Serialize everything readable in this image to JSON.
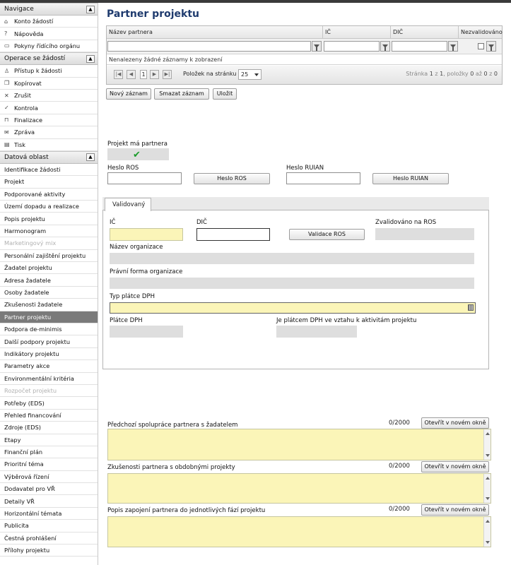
{
  "sidebar": {
    "sections": [
      {
        "title": "Navigace",
        "items": [
          {
            "label": "Konto žádostí",
            "icon": "home-icon",
            "glyph": "⌂"
          },
          {
            "label": "Nápověda",
            "icon": "help-icon",
            "glyph": "?"
          },
          {
            "label": "Pokyny řídícího orgánu",
            "icon": "book-icon",
            "glyph": "▭"
          }
        ]
      },
      {
        "title": "Operace se žádostí",
        "items": [
          {
            "label": "Přístup k žádosti",
            "icon": "user-icon",
            "glyph": "♙"
          },
          {
            "label": "Kopírovat",
            "icon": "copy-icon",
            "glyph": "❐"
          },
          {
            "label": "Zrušit",
            "icon": "close-icon",
            "glyph": "✕"
          },
          {
            "label": "Kontrola",
            "icon": "check-icon",
            "glyph": "✓"
          },
          {
            "label": "Finalizace",
            "icon": "lock-icon",
            "glyph": "⊓"
          },
          {
            "label": "Zpráva",
            "icon": "message-icon",
            "glyph": "✉"
          },
          {
            "label": "Tisk",
            "icon": "print-icon",
            "glyph": "▤"
          }
        ]
      },
      {
        "title": "Datová oblast",
        "items": [
          {
            "label": "Identifikace žádosti"
          },
          {
            "label": "Projekt"
          },
          {
            "label": "Podporované aktivity"
          },
          {
            "label": "Území dopadu a realizace"
          },
          {
            "label": "Popis projektu"
          },
          {
            "label": "Harmonogram"
          },
          {
            "label": "Marketingový mix",
            "disabled": true
          },
          {
            "label": "Personální zajištění projektu"
          },
          {
            "label": "Žadatel projektu"
          },
          {
            "label": "Adresa žadatele"
          },
          {
            "label": "Osoby žadatele"
          },
          {
            "label": "Zkušenosti žadatele"
          },
          {
            "label": "Partner projektu",
            "active": true
          },
          {
            "label": "Podpora de-minimis"
          },
          {
            "label": "Další podpory projektu"
          },
          {
            "label": "Indikátory projektu"
          },
          {
            "label": "Parametry akce"
          },
          {
            "label": "Environmentální kritéria"
          },
          {
            "label": "Rozpočet projektu",
            "disabled": true
          },
          {
            "label": "Potřeby (EDS)"
          },
          {
            "label": "Přehled financování"
          },
          {
            "label": "Zdroje (EDS)"
          },
          {
            "label": "Etapy"
          },
          {
            "label": "Finanční plán"
          },
          {
            "label": "Prioritní téma"
          },
          {
            "label": "Výběrová řízení"
          },
          {
            "label": "Dodavatel pro VŘ"
          },
          {
            "label": "Detaily VŘ"
          },
          {
            "label": "Horizontální témata"
          },
          {
            "label": "Publicita"
          },
          {
            "label": "Čestná prohlášení"
          },
          {
            "label": "Přílohy projektu"
          }
        ]
      }
    ]
  },
  "page": {
    "title": "Partner projektu"
  },
  "grid": {
    "columns": [
      "Název partnera",
      "IČ",
      "DIČ",
      "Nezvalidováno"
    ],
    "empty_text": "Nenalezeny žádné záznamy k zobrazení",
    "pager": {
      "page": "1",
      "per_page_label": "Položek na stránku",
      "per_page": "25",
      "info_prefix": "Stránka",
      "page_current": "1",
      "of": "z",
      "page_total": "1",
      "items_label": ", položky",
      "item_from": "0",
      "to": "až",
      "item_to": "0",
      "of2": "z",
      "item_total": "0"
    }
  },
  "toolbar": {
    "new": "Nový záznam",
    "delete": "Smazat záznam",
    "save": "Uložit"
  },
  "form": {
    "has_partner_label": "Projekt má partnera",
    "heslo_ros_label": "Heslo ROS",
    "heslo_ros_button": "Heslo ROS",
    "heslo_ruian_label": "Heslo RUIAN",
    "heslo_ruian_button": "Heslo RUIAN",
    "tab_label": "Validovaný",
    "ic_label": "IČ",
    "dic_label": "DIČ",
    "validate_button": "Validace ROS",
    "validated_ros_label": "Zvalidováno na ROS",
    "org_name_label": "Název organizace",
    "legal_form_label": "Právní forma organizace",
    "vat_type_label": "Typ plátce DPH",
    "vat_payer_label": "Plátce DPH",
    "vat_activities_label": "Je plátcem DPH ve vztahu k aktivitám projektu"
  },
  "textareas": [
    {
      "label": "Předchozí spolupráce partnera s žadatelem",
      "counter": "0/2000",
      "button": "Otevřít v novém okně"
    },
    {
      "label": "Zkušenosti partnera s obdobnými projekty",
      "counter": "0/2000",
      "button": "Otevřít v novém okně"
    },
    {
      "label": "Popis zapojení partnera do jednotlivých fází projektu",
      "counter": "0/2000",
      "button": "Otevřít v novém okně"
    }
  ],
  "colors": {
    "title": "#1f3b6e",
    "active_item": "#7a7a7a",
    "field_yellow": "#fbf5b8",
    "check_green": "#1a9b2a"
  }
}
